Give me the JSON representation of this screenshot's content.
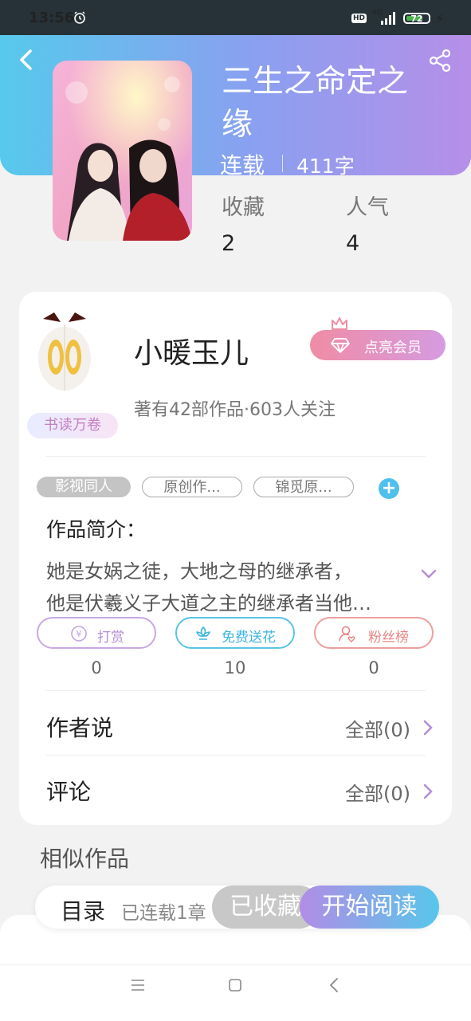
{
  "status_bar": {
    "time": "13:56",
    "hd": "HD",
    "network": "4G",
    "battery": "72"
  },
  "book": {
    "title": "三生之命定之缘",
    "status": "连载",
    "word_count": "411字",
    "favorites_label": "收藏",
    "favorites": "2",
    "popularity_label": "人气",
    "popularity": "4"
  },
  "author": {
    "badge": "书读万卷",
    "name": "小暖玉儿",
    "vip_button": "点亮会员",
    "meta": "著有42部作品·603人关注"
  },
  "tags": [
    "影视同人",
    "原创作...",
    "锦觅原..."
  ],
  "intro": {
    "title": "作品简介：",
    "line1": "她是女娲之徒，大地之母的继承者，",
    "line2": "他是伏羲义子大道之主的继承者当他…"
  },
  "actions": {
    "tip": {
      "label": "打赏",
      "count": "0"
    },
    "flower": {
      "label": "免费送花",
      "count": "10"
    },
    "fans": {
      "label": "粉丝榜",
      "count": "0"
    }
  },
  "rows": {
    "author_says": {
      "label": "作者说",
      "value": "全部(0)"
    },
    "comments": {
      "label": "评论",
      "value": "全部(0)"
    }
  },
  "similar_title": "相似作品",
  "bottom_bar": {
    "toc": "目录",
    "toc_count": "已连载1章",
    "collected": "已收藏",
    "start_read": "开始阅读"
  },
  "colors": {
    "header_gradient": [
      "#57c9ec",
      "#b68fe8"
    ],
    "accent_blue": "#4fc0ec",
    "tip_purple": "#b48ed8",
    "flower_blue": "#3fb5e0",
    "fans_red": "#e88484"
  }
}
